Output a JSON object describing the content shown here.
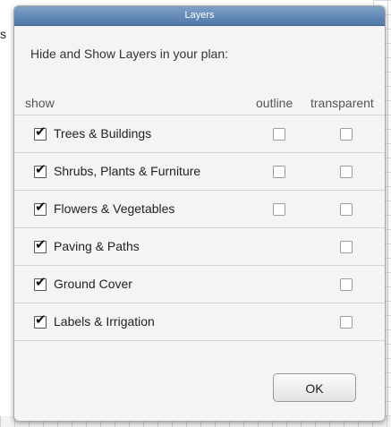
{
  "page_edge_text": "s",
  "dialog": {
    "title": "Layers",
    "instructions": "Hide and Show Layers in your plan:",
    "columns": {
      "show": "show",
      "outline": "outline",
      "transparent": "transparent"
    },
    "layers": [
      {
        "label": "Trees & Buildings",
        "show": true,
        "has_outline": true,
        "outline": false,
        "transparent": false
      },
      {
        "label": "Shrubs, Plants & Furniture",
        "show": true,
        "has_outline": true,
        "outline": false,
        "transparent": false
      },
      {
        "label": "Flowers & Vegetables",
        "show": true,
        "has_outline": true,
        "outline": false,
        "transparent": false
      },
      {
        "label": "Paving & Paths",
        "show": true,
        "has_outline": false,
        "outline": false,
        "transparent": false
      },
      {
        "label": "Ground Cover",
        "show": true,
        "has_outline": false,
        "outline": false,
        "transparent": false
      },
      {
        "label": "Labels & Irrigation",
        "show": true,
        "has_outline": false,
        "outline": false,
        "transparent": false
      }
    ],
    "ok_label": "OK"
  },
  "colors": {
    "titlebar_top": "#7fa1c7",
    "titlebar_bottom": "#4f78a8",
    "dialog_bg": "#f4f4f4"
  }
}
